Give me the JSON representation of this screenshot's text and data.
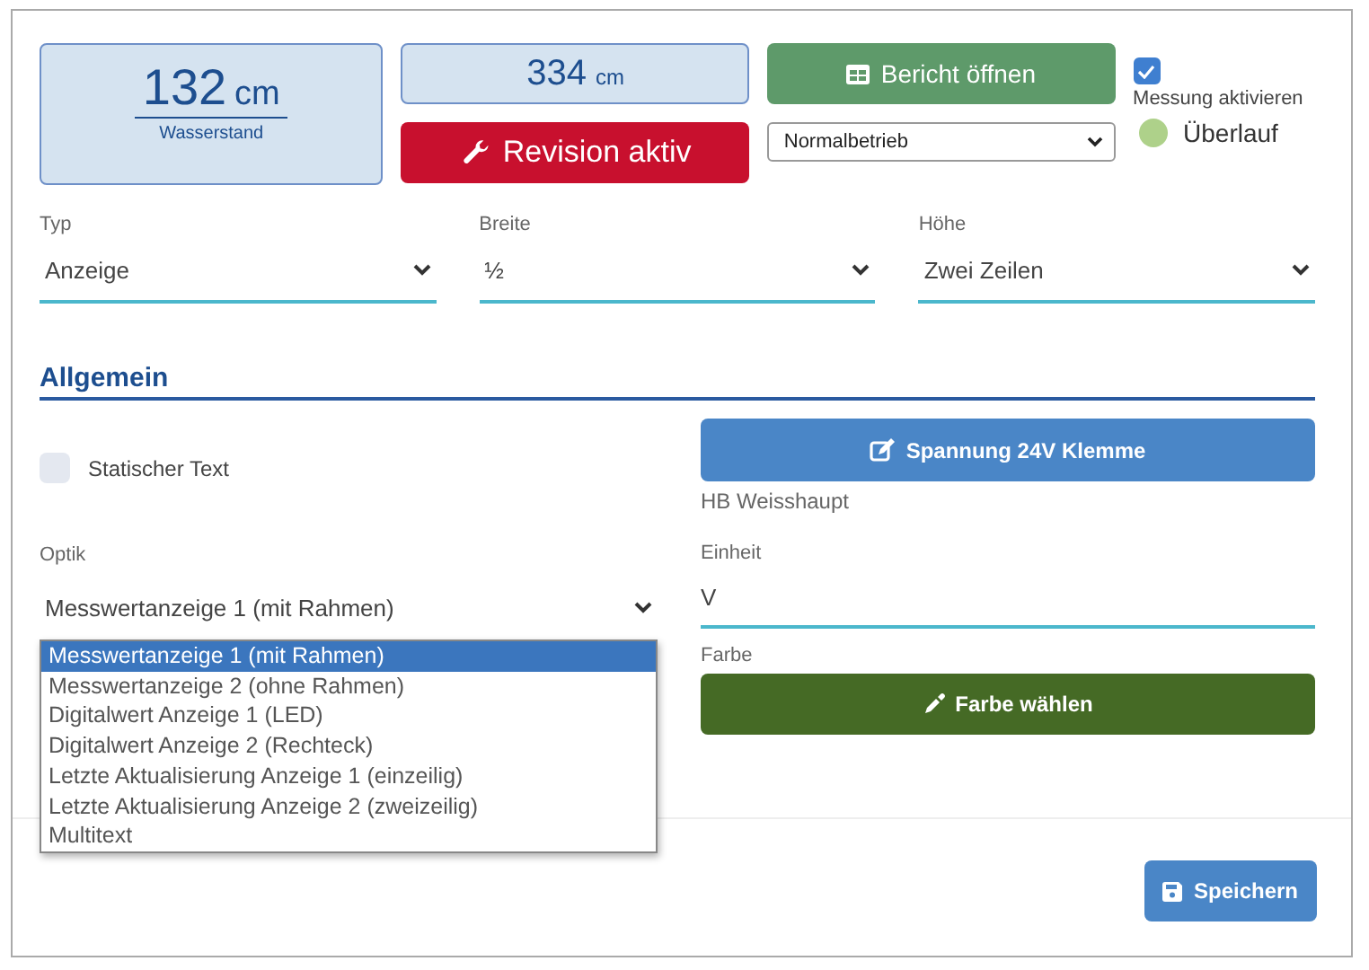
{
  "level_card": {
    "value": "132",
    "unit": "cm",
    "caption": "Wasserstand"
  },
  "secondary_reading": {
    "value": "334",
    "unit": "cm"
  },
  "revision_button": {
    "label": "Revision aktiv"
  },
  "report_button": {
    "label": "Bericht öffnen"
  },
  "mode_select": {
    "value": "Normalbetrieb"
  },
  "measurement": {
    "label": "Messung aktivieren",
    "checked": true
  },
  "indicator": {
    "label": "Überlauf",
    "color": "#aed18a"
  },
  "fields": [
    {
      "label": "Typ",
      "value": "Anzeige"
    },
    {
      "label": "Breite",
      "value": "½"
    },
    {
      "label": "Höhe",
      "value": "Zwei Zeilen"
    }
  ],
  "section": {
    "title": "Allgemein"
  },
  "static_text": {
    "label": "Statischer Text",
    "checked": false
  },
  "optik": {
    "label": "Optik",
    "value": "Messwertanzeige 1 (mit Rahmen)",
    "expanded": true,
    "options": [
      {
        "label": "Messwertanzeige 1 (mit Rahmen)",
        "selected": true
      },
      {
        "label": "Messwertanzeige 2 (ohne Rahmen)",
        "selected": false
      },
      {
        "label": "Digitalwert Anzeige 1 (LED)",
        "selected": false
      },
      {
        "label": "Digitalwert Anzeige 2 (Rechteck)",
        "selected": false
      },
      {
        "label": "Letzte Aktualisierung Anzeige 1 (einzeilig)",
        "selected": false
      },
      {
        "label": "Letzte Aktualisierung Anzeige 2 (zweizeilig)",
        "selected": false
      },
      {
        "label": "Multitext",
        "selected": false
      }
    ]
  },
  "sensor_button": {
    "label": "Spannung 24V Klemme"
  },
  "location": "HB Weisshaupt",
  "unit_field": {
    "label": "Einheit",
    "value": "V"
  },
  "color_field": {
    "label": "Farbe",
    "button": "Farbe wählen"
  },
  "save_button": {
    "label": "Speichern"
  }
}
